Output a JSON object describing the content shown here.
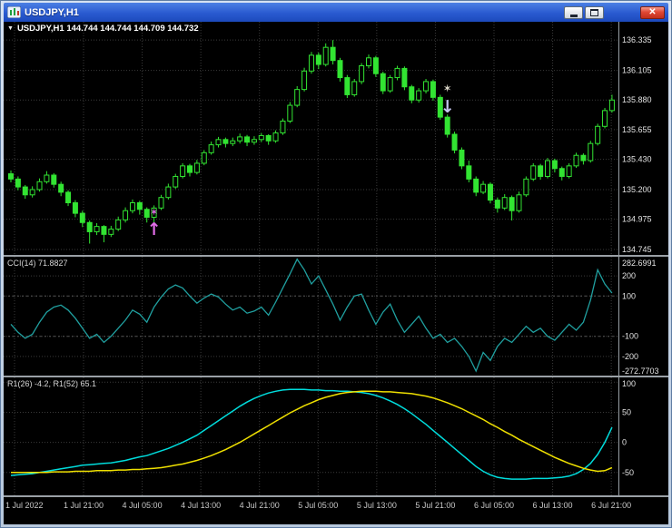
{
  "window": {
    "title": "USDJPY,H1",
    "close_glyph": "✕"
  },
  "chart": {
    "header": {
      "dropdown_icon": "▼",
      "symbol_info": "USDJPY,H1 144.744 144.744 144.709 144.732"
    }
  },
  "colors": {
    "grid": "#3a3a3a",
    "axis_text": "#e2e2e2",
    "candle": "#32e432",
    "panel_bg": "#000000",
    "separator": "#9aa0a6",
    "cci_line": "#20a0a0",
    "r1_fast": "#00dcdc",
    "r1_slow": "#efe000"
  },
  "icon_glyphs": {
    "star": "✶",
    "arrow-up": "↑",
    "arrow-down": "↓"
  },
  "time_axis": {
    "labels": [
      "1 Jul 2022",
      "1 Jul 21:00",
      "4 Jul 05:00",
      "4 Jul 13:00",
      "4 Jul 21:00",
      "5 Jul 05:00",
      "5 Jul 13:00",
      "5 Jul 21:00",
      "6 Jul 05:00",
      "6 Jul 13:00",
      "6 Jul 21:00"
    ]
  },
  "chart_data": [
    {
      "type": "candlestick",
      "title": "USDJPY,H1",
      "y_axis_labels": [
        "136.335",
        "136.105",
        "135.880",
        "135.655",
        "135.430",
        "135.200",
        "134.975",
        "134.745"
      ],
      "y_min": 134.704,
      "y_max": 136.474,
      "candles": [
        [
          135.32,
          135.345,
          135.255,
          135.28
        ],
        [
          135.28,
          135.3,
          135.195,
          135.22
        ],
        [
          135.22,
          135.235,
          135.13,
          135.16
        ],
        [
          135.16,
          135.225,
          135.14,
          135.2
        ],
        [
          135.2,
          135.285,
          135.185,
          135.26
        ],
        [
          135.26,
          135.34,
          135.245,
          135.31
        ],
        [
          135.31,
          135.325,
          135.215,
          135.24
        ],
        [
          135.24,
          135.26,
          135.15,
          135.18
        ],
        [
          135.18,
          135.195,
          135.075,
          135.1
        ],
        [
          135.1,
          135.12,
          134.99,
          135.02
        ],
        [
          135.02,
          135.04,
          134.915,
          134.95
        ],
        [
          134.95,
          134.965,
          134.79,
          134.88
        ],
        [
          134.88,
          134.945,
          134.855,
          134.92
        ],
        [
          134.92,
          134.93,
          134.8,
          134.86
        ],
        [
          134.86,
          134.925,
          134.84,
          134.9
        ],
        [
          134.9,
          134.995,
          134.885,
          134.97
        ],
        [
          134.97,
          135.065,
          134.95,
          135.04
        ],
        [
          135.04,
          135.125,
          135.02,
          135.1
        ],
        [
          135.1,
          135.115,
          135.01,
          135.05
        ],
        [
          135.05,
          135.065,
          134.95,
          134.99
        ],
        [
          134.99,
          135.08,
          134.93,
          135.06
        ],
        [
          135.06,
          135.16,
          135.045,
          135.14
        ],
        [
          135.14,
          135.245,
          135.125,
          135.22
        ],
        [
          135.22,
          135.32,
          135.205,
          135.3
        ],
        [
          135.3,
          135.4,
          135.285,
          135.38
        ],
        [
          135.38,
          135.395,
          135.3,
          135.33
        ],
        [
          135.33,
          135.425,
          135.315,
          135.4
        ],
        [
          135.4,
          135.5,
          135.385,
          135.48
        ],
        [
          135.48,
          135.565,
          135.465,
          135.54
        ],
        [
          135.54,
          135.6,
          135.52,
          135.58
        ],
        [
          135.58,
          135.595,
          135.52,
          135.55
        ],
        [
          135.55,
          135.595,
          135.53,
          135.57
        ],
        [
          135.57,
          135.625,
          135.55,
          135.6
        ],
        [
          135.6,
          135.615,
          135.53,
          135.56
        ],
        [
          135.56,
          135.605,
          135.54,
          135.58
        ],
        [
          135.58,
          135.63,
          135.56,
          135.61
        ],
        [
          135.61,
          135.62,
          135.54,
          135.57
        ],
        [
          135.57,
          135.65,
          135.555,
          135.63
        ],
        [
          135.63,
          135.74,
          135.615,
          135.72
        ],
        [
          135.72,
          135.865,
          135.705,
          135.84
        ],
        [
          135.84,
          135.985,
          135.825,
          135.96
        ],
        [
          135.96,
          136.125,
          135.945,
          136.1
        ],
        [
          136.1,
          136.245,
          136.08,
          136.22
        ],
        [
          136.22,
          136.24,
          136.115,
          136.15
        ],
        [
          136.15,
          136.31,
          136.135,
          136.28
        ],
        [
          136.28,
          136.335,
          136.15,
          136.18
        ],
        [
          136.18,
          136.2,
          136.02,
          136.05
        ],
        [
          136.05,
          136.07,
          135.895,
          135.92
        ],
        [
          135.92,
          136.04,
          135.905,
          136.02
        ],
        [
          136.02,
          136.16,
          136.0,
          136.14
        ],
        [
          136.14,
          136.225,
          136.12,
          136.2
        ],
        [
          136.2,
          136.215,
          136.055,
          136.08
        ],
        [
          136.08,
          136.095,
          135.925,
          135.95
        ],
        [
          135.95,
          136.07,
          135.935,
          136.05
        ],
        [
          136.05,
          136.14,
          136.03,
          136.12
        ],
        [
          136.12,
          136.135,
          135.955,
          135.98
        ],
        [
          135.98,
          135.995,
          135.855,
          135.88
        ],
        [
          135.88,
          135.97,
          135.86,
          135.95
        ],
        [
          135.95,
          136.04,
          135.93,
          136.02
        ],
        [
          136.02,
          136.035,
          135.875,
          135.9
        ],
        [
          135.9,
          135.92,
          135.73,
          135.75
        ],
        [
          135.75,
          135.77,
          135.595,
          135.62
        ],
        [
          135.62,
          135.64,
          135.475,
          135.5
        ],
        [
          135.5,
          135.52,
          135.355,
          135.38
        ],
        [
          135.38,
          135.42,
          135.255,
          135.28
        ],
        [
          135.28,
          135.3,
          135.15,
          135.18
        ],
        [
          135.18,
          135.265,
          135.165,
          135.24
        ],
        [
          135.24,
          135.255,
          135.095,
          135.12
        ],
        [
          135.12,
          135.14,
          135.025,
          135.06
        ],
        [
          135.06,
          135.165,
          135.045,
          135.14
        ],
        [
          135.14,
          135.155,
          134.965,
          135.04
        ],
        [
          135.04,
          135.185,
          135.025,
          135.16
        ],
        [
          135.16,
          135.3,
          135.145,
          135.28
        ],
        [
          135.28,
          135.4,
          135.265,
          135.38
        ],
        [
          135.38,
          135.395,
          135.275,
          135.3
        ],
        [
          135.3,
          135.44,
          135.285,
          135.42
        ],
        [
          135.42,
          135.435,
          135.33,
          135.36
        ],
        [
          135.36,
          135.375,
          135.27,
          135.3
        ],
        [
          135.3,
          135.4,
          135.285,
          135.38
        ],
        [
          135.38,
          135.48,
          135.365,
          135.46
        ],
        [
          135.46,
          135.475,
          135.39,
          135.42
        ],
        [
          135.42,
          135.57,
          135.405,
          135.55
        ],
        [
          135.55,
          135.7,
          135.535,
          135.68
        ],
        [
          135.68,
          135.82,
          135.665,
          135.8
        ],
        [
          135.8,
          135.92,
          135.785,
          135.88
        ]
      ],
      "markers": [
        {
          "shape": "star",
          "index": 20,
          "price": 135.03,
          "color": "#e06ce6",
          "size": 11
        },
        {
          "shape": "arrow-up",
          "index": 20,
          "price": 134.9,
          "color": "#e06ce6",
          "size": 19
        },
        {
          "shape": "star",
          "index": 61,
          "price": 135.97,
          "color": "#ddd8ca",
          "size": 12
        },
        {
          "shape": "arrow-down",
          "index": 61,
          "price": 135.83,
          "color": "#c6c6f0",
          "size": 19
        }
      ]
    },
    {
      "type": "line",
      "name": "CCI(14)",
      "label": "CCI(14) 71.8827",
      "current_value": 71.8827,
      "y_axis_labels": [
        "282.6991",
        "200",
        "100",
        "-100",
        "-200",
        "-272.7703"
      ],
      "grid_values": [
        200,
        100,
        -100,
        -200
      ],
      "levels": [
        100,
        -100
      ],
      "y_min": -295,
      "y_max": 295,
      "values": [
        -40,
        -80,
        -110,
        -90,
        -30,
        20,
        45,
        55,
        30,
        -10,
        -60,
        -110,
        -90,
        -130,
        -100,
        -60,
        -20,
        30,
        10,
        -30,
        45,
        95,
        135,
        155,
        140,
        100,
        65,
        90,
        110,
        95,
        60,
        30,
        45,
        15,
        25,
        45,
        5,
        70,
        140,
        210,
        282.7,
        230,
        160,
        200,
        130,
        60,
        -20,
        45,
        100,
        110,
        30,
        -40,
        20,
        60,
        -20,
        -80,
        -40,
        0,
        -60,
        -110,
        -90,
        -130,
        -110,
        -150,
        -200,
        -272.7,
        -180,
        -220,
        -150,
        -110,
        -130,
        -90,
        -50,
        -80,
        -60,
        -100,
        -120,
        -80,
        -40,
        -70,
        -30,
        80,
        230,
        160,
        115
      ]
    },
    {
      "type": "line",
      "name": "R1",
      "label": "R1(26) -4.2, R1(52) 65.1",
      "y_axis_labels": [
        "100",
        "50",
        "0",
        "-50"
      ],
      "grid_values": [
        100,
        50,
        0,
        -50
      ],
      "y_min": -88,
      "y_max": 108,
      "series": [
        {
          "name": "R1(26)",
          "color": "#00dcdc",
          "values": [
            -55,
            -54,
            -53,
            -52,
            -50,
            -48,
            -46,
            -44,
            -42,
            -40,
            -38,
            -37,
            -36,
            -35,
            -34,
            -32,
            -30,
            -27,
            -24,
            -22,
            -18,
            -14,
            -10,
            -5,
            0,
            6,
            12,
            20,
            28,
            36,
            44,
            52,
            60,
            67,
            73,
            78,
            82,
            85,
            87,
            88,
            88,
            88,
            87,
            87,
            86,
            86,
            85,
            85,
            84,
            83,
            81,
            78,
            74,
            69,
            63,
            56,
            48,
            39,
            30,
            20,
            10,
            0,
            -10,
            -20,
            -30,
            -40,
            -48,
            -54,
            -58,
            -60,
            -61,
            -61,
            -61,
            -60,
            -60,
            -60,
            -59,
            -58,
            -56,
            -52,
            -45,
            -35,
            -20,
            0,
            25
          ]
        },
        {
          "name": "R1(52)",
          "color": "#efe000",
          "values": [
            -50,
            -50,
            -50,
            -50,
            -50,
            -50,
            -49,
            -49,
            -49,
            -48,
            -48,
            -48,
            -47,
            -47,
            -47,
            -46,
            -46,
            -45,
            -45,
            -44,
            -43,
            -42,
            -40,
            -38,
            -36,
            -33,
            -30,
            -26,
            -22,
            -17,
            -12,
            -6,
            0,
            7,
            14,
            21,
            28,
            35,
            42,
            49,
            55,
            61,
            66,
            71,
            75,
            78,
            81,
            83,
            84,
            85,
            85,
            85,
            84,
            84,
            83,
            82,
            81,
            79,
            77,
            74,
            70,
            66,
            61,
            56,
            50,
            44,
            38,
            31,
            25,
            18,
            12,
            5,
            -1,
            -7,
            -13,
            -19,
            -25,
            -30,
            -35,
            -39,
            -43,
            -46,
            -48,
            -47,
            -42
          ]
        }
      ]
    }
  ]
}
